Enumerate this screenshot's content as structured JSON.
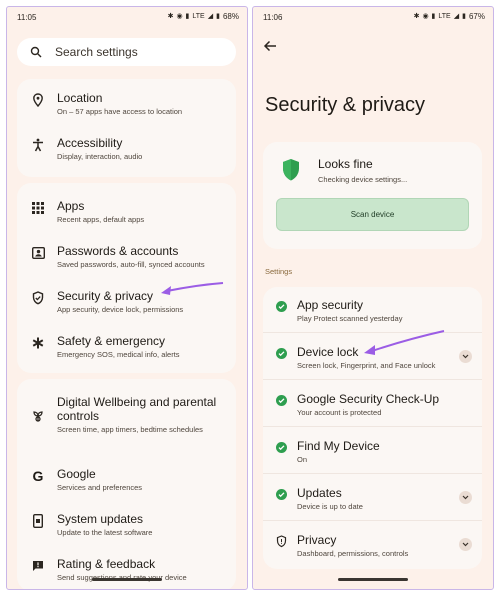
{
  "left_phone": {
    "status": {
      "time": "11:05",
      "network": "LTE",
      "battery": "68%"
    },
    "search": {
      "placeholder": "Search settings"
    },
    "group1": [
      {
        "icon": "location-pin-icon",
        "title": "Location",
        "subtitle": "On – 57 apps have access to location"
      },
      {
        "icon": "accessibility-icon",
        "title": "Accessibility",
        "subtitle": "Display, interaction, audio"
      }
    ],
    "group2": [
      {
        "icon": "apps-grid-icon",
        "title": "Apps",
        "subtitle": "Recent apps, default apps"
      },
      {
        "icon": "passwords-accounts-icon",
        "title": "Passwords & accounts",
        "subtitle": "Saved passwords, auto-fill, synced accounts"
      },
      {
        "icon": "shield-icon",
        "title": "Security & privacy",
        "subtitle": "App security, device lock, permissions"
      },
      {
        "icon": "asterisk-icon",
        "title": "Safety & emergency",
        "subtitle": "Emergency SOS, medical info, alerts"
      }
    ],
    "group3": [
      {
        "icon": "wellbeing-icon",
        "title": "Digital Wellbeing and parental controls",
        "subtitle": "Screen time, app timers, bedtime schedules"
      },
      {
        "icon": "google-icon",
        "title": "Google",
        "subtitle": "Services and preferences"
      },
      {
        "icon": "system-update-icon",
        "title": "System updates",
        "subtitle": "Update to the latest software"
      },
      {
        "icon": "feedback-icon",
        "title": "Rating & feedback",
        "subtitle": "Send suggestions and rate your device"
      }
    ]
  },
  "right_phone": {
    "status": {
      "time": "11:06",
      "network": "LTE",
      "battery": "67%"
    },
    "title": "Security & privacy",
    "status_card": {
      "title": "Looks fine",
      "subtitle": "Checking device settings...",
      "button": "Scan device"
    },
    "section_label": "Settings",
    "items": [
      {
        "icon": "check-circle-icon",
        "title": "App security",
        "subtitle": "Play Protect scanned yesterday",
        "expandable": false
      },
      {
        "icon": "check-circle-icon",
        "title": "Device lock",
        "subtitle": "Screen lock, Fingerprint, and Face unlock",
        "expandable": true
      },
      {
        "icon": "check-circle-icon",
        "title": "Google Security Check-Up",
        "subtitle": "Your account is protected",
        "expandable": false
      },
      {
        "icon": "check-circle-icon",
        "title": "Find My Device",
        "subtitle": "On",
        "expandable": false
      },
      {
        "icon": "check-circle-icon",
        "title": "Updates",
        "subtitle": "Device is up to date",
        "expandable": true
      },
      {
        "icon": "privacy-shield-icon",
        "title": "Privacy",
        "subtitle": "Dashboard, permissions, controls",
        "expandable": true
      }
    ]
  },
  "colors": {
    "accent_green": "#2e9e4f",
    "annotation_purple": "#9b5de5",
    "background": "#fdf1ea"
  }
}
